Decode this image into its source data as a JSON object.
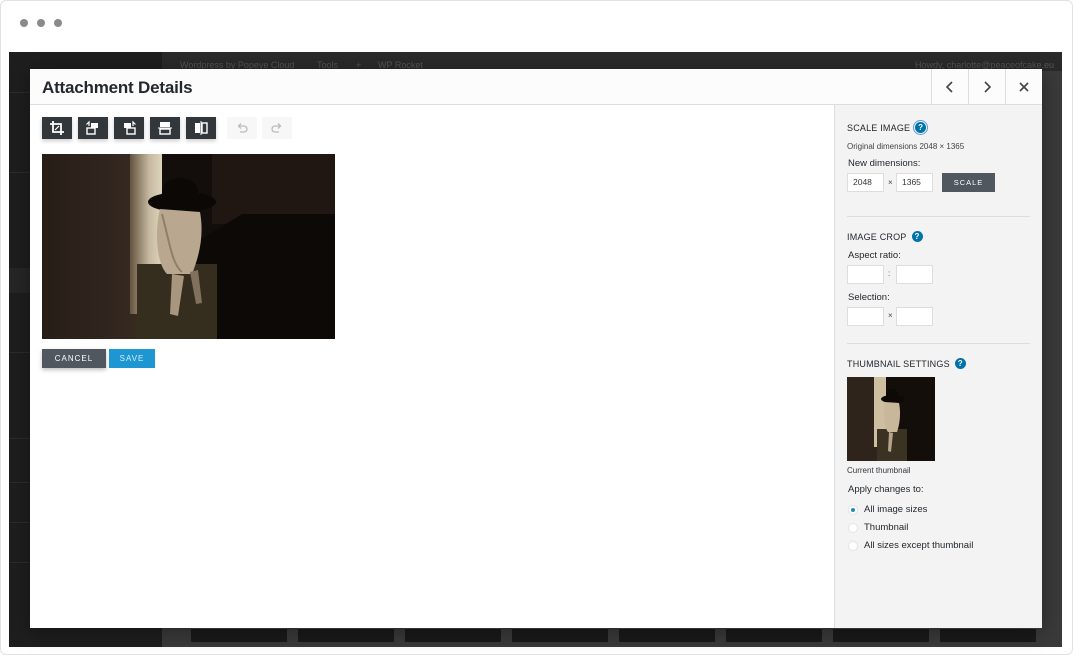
{
  "background_app": {
    "topbar_items": [
      "Wordpress by Popeye Cloud",
      "Tools",
      "+",
      "WP Rocket"
    ],
    "greeting": "Howdy, charlotte@peaceofcake.eu"
  },
  "modal": {
    "title": "Attachment Details"
  },
  "editor": {
    "tools": [
      {
        "name": "crop",
        "icon": "crop-icon"
      },
      {
        "name": "rotate-left",
        "icon": "rotate-left-icon"
      },
      {
        "name": "rotate-right",
        "icon": "rotate-right-icon"
      },
      {
        "name": "flip-vertical",
        "icon": "flip-vertical-icon"
      },
      {
        "name": "flip-horizontal",
        "icon": "flip-horizontal-icon"
      }
    ],
    "cancel_label": "CANCEL",
    "save_label": "SAVE"
  },
  "sidebar": {
    "scale": {
      "title": "SCALE IMAGE",
      "original": "Original dimensions 2048 × 1365",
      "new_label": "New dimensions:",
      "width": "2048",
      "height": "1365",
      "x": "×",
      "button": "SCALE"
    },
    "crop": {
      "title": "IMAGE CROP",
      "aspect_label": "Aspect ratio:",
      "aspect_sep": ":",
      "selection_label": "Selection:",
      "selection_sep": "×"
    },
    "thumbnail": {
      "title": "THUMBNAIL SETTINGS",
      "current_label": "Current thumbnail",
      "apply_label": "Apply changes to:",
      "options": [
        {
          "label": "All image sizes",
          "selected": true
        },
        {
          "label": "Thumbnail",
          "selected": false
        },
        {
          "label": "All sizes except thumbnail",
          "selected": false
        }
      ]
    },
    "help_glyph": "?"
  },
  "colors": {
    "primary_button": "#32373c",
    "accent_blue": "#1e96d2",
    "help_blue": "#0073aa"
  }
}
